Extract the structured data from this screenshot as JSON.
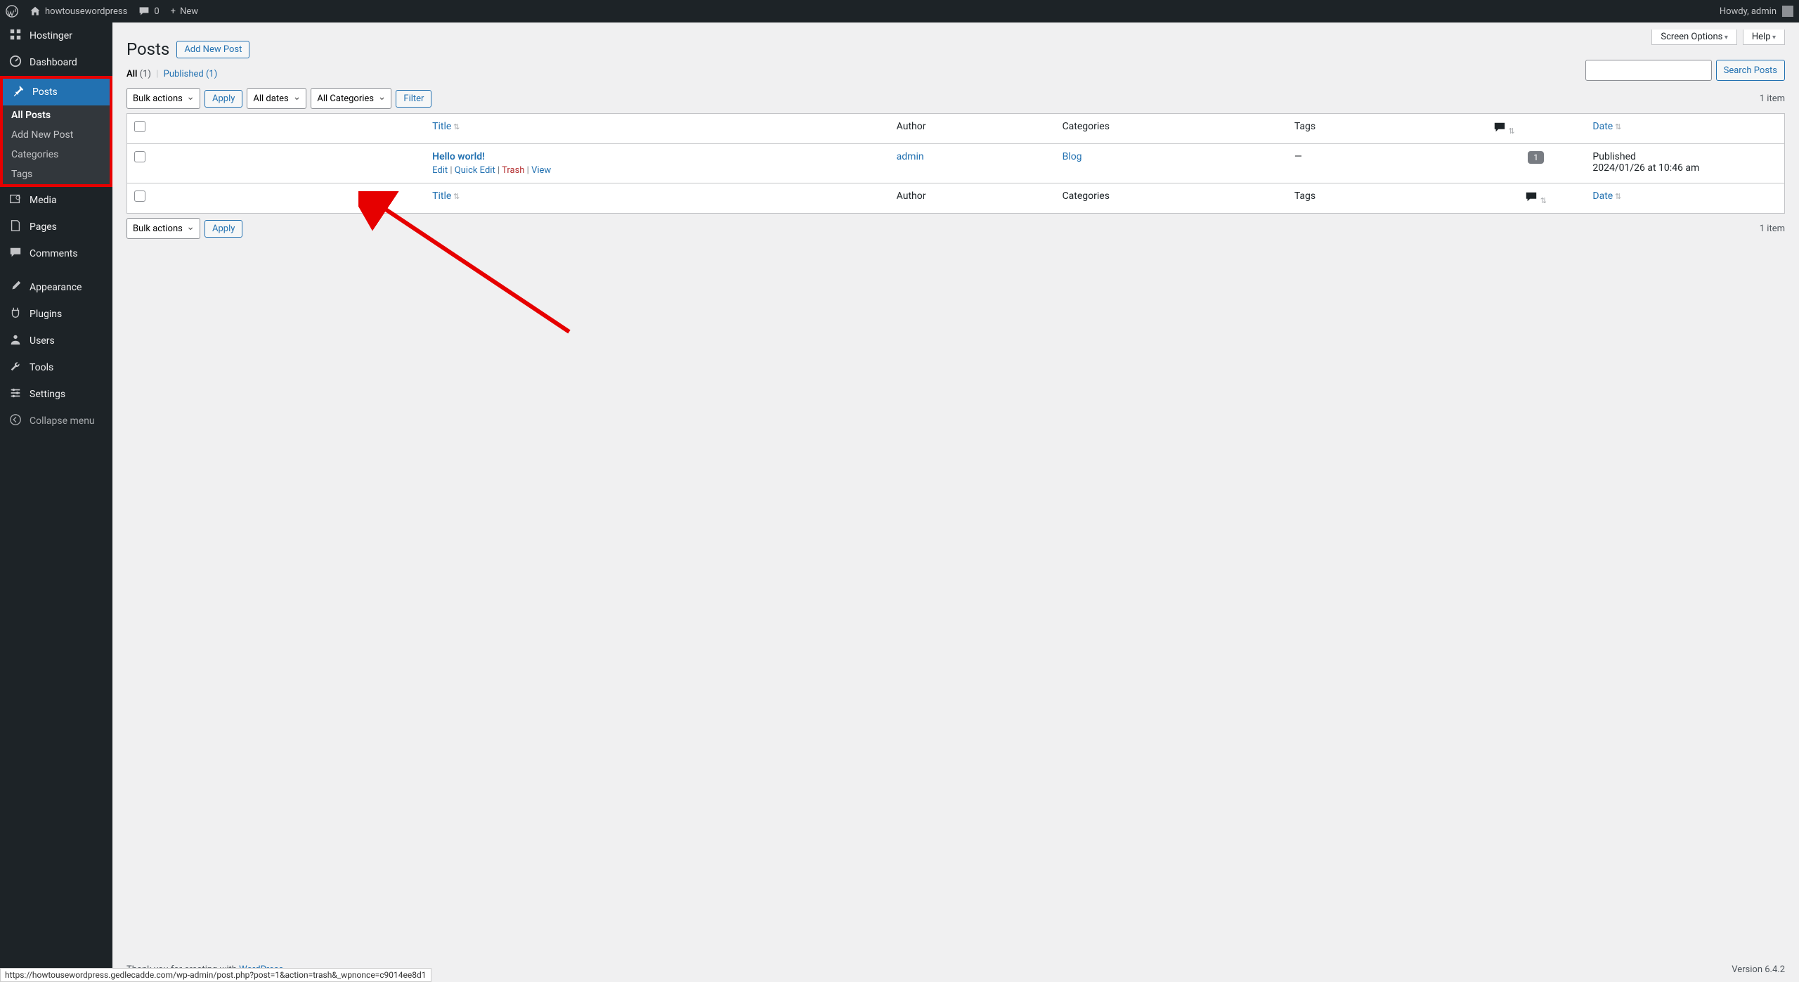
{
  "adminbar": {
    "site_name": "howtousewordpress",
    "comments_count": "0",
    "new_label": "New",
    "greeting": "Howdy, admin"
  },
  "sidebar": {
    "hostinger": "Hostinger",
    "dashboard": "Dashboard",
    "posts": "Posts",
    "submenu": {
      "all_posts": "All Posts",
      "add_new": "Add New Post",
      "categories": "Categories",
      "tags": "Tags"
    },
    "media": "Media",
    "pages": "Pages",
    "comments": "Comments",
    "appearance": "Appearance",
    "plugins": "Plugins",
    "users": "Users",
    "tools": "Tools",
    "settings": "Settings",
    "collapse": "Collapse menu"
  },
  "screen": {
    "options": "Screen Options",
    "help": "Help"
  },
  "page": {
    "title": "Posts",
    "add_new": "Add New Post"
  },
  "views": {
    "all_label": "All",
    "all_count": "(1)",
    "published_label": "Published",
    "published_count": "(1)"
  },
  "search": {
    "button": "Search Posts"
  },
  "bulk": {
    "label": "Bulk actions",
    "apply": "Apply"
  },
  "filters": {
    "dates": "All dates",
    "categories": "All Categories",
    "filter": "Filter"
  },
  "item_count": "1 item",
  "columns": {
    "title": "Title",
    "author": "Author",
    "categories": "Categories",
    "tags": "Tags",
    "date": "Date"
  },
  "post": {
    "title": "Hello world!",
    "author": "admin",
    "category": "Blog",
    "tags": "—",
    "comment_count": "1",
    "date_status": "Published",
    "date_value": "2024/01/26 at 10:46 am",
    "actions": {
      "edit": "Edit",
      "quick_edit": "Quick Edit",
      "trash": "Trash",
      "view": "View"
    }
  },
  "footer": {
    "thanks": "Thank you for creating with ",
    "wp": "WordPress",
    "version": "Version 6.4.2"
  },
  "status_url": "https://howtousewordpress.gedlecadde.com/wp-admin/post.php?post=1&action=trash&_wpnonce=c9014ee8d1"
}
